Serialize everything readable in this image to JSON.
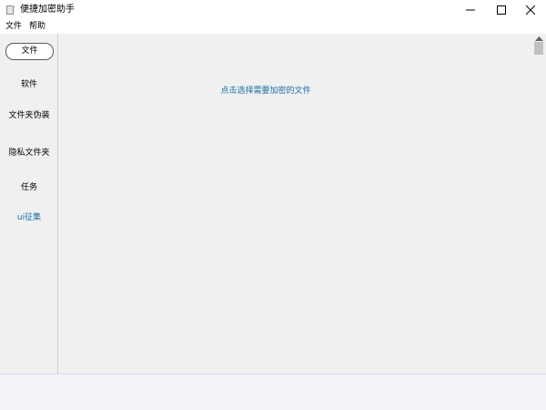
{
  "window": {
    "title": "便捷加密助手",
    "icon": "app-file-icon"
  },
  "titlebar_buttons": {
    "minimize": "minimize-icon",
    "maximize": "maximize-icon",
    "close": "close-icon"
  },
  "menu": {
    "file": "文件",
    "help": "帮助"
  },
  "sidebar": {
    "items": [
      {
        "label": "文件",
        "selected": true
      },
      {
        "label": "软件"
      },
      {
        "label": "文件夹伪装"
      },
      {
        "label": "隐私文件夹"
      },
      {
        "label": "任务"
      },
      {
        "label": "ui征集"
      }
    ]
  },
  "main": {
    "hint": "点击选择需要加密的文件"
  },
  "colors": {
    "accent": "#1a6fa6",
    "background": "#f0f0f0",
    "bottom_panel": "#f2f4f8"
  }
}
